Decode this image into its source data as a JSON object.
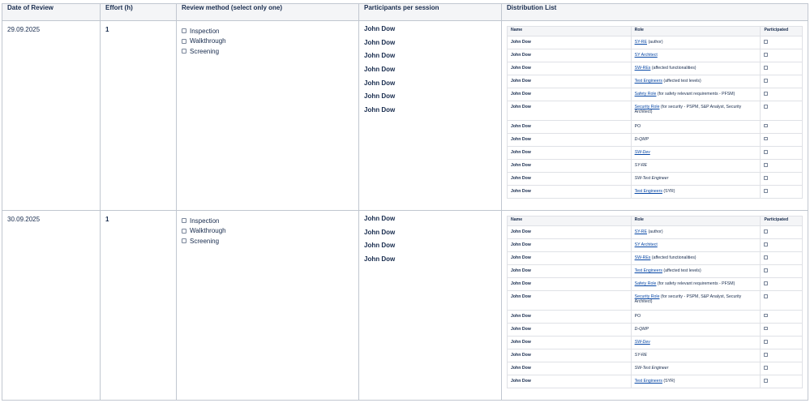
{
  "headers": {
    "date": "Date of Review",
    "effort": "Effort (h)",
    "method": "Review method (select only one)",
    "participants": "Participants per session",
    "distribution": "Distribution List"
  },
  "method_options": [
    "Inspection",
    "Walkthrough",
    "Screening"
  ],
  "distribution_headers": {
    "name": "Name",
    "role": "Role",
    "participated": "Participated"
  },
  "sessions": [
    {
      "date": "29.09.2025",
      "effort": "1",
      "participants": [
        "John Dow",
        "John Dow",
        "John Dow",
        "John Dow",
        "John Dow",
        "John Dow",
        "John Dow"
      ],
      "distribution": [
        {
          "name": "John Dow",
          "role_link": "SY-RE",
          "role_rest": " (author)",
          "italic": false
        },
        {
          "name": "John Dow",
          "role_link": "SY Architect",
          "role_rest": "",
          "italic": false
        },
        {
          "name": "John Dow",
          "role_link": "SW-REs",
          "role_rest": " (affected functionalities)",
          "italic": false
        },
        {
          "name": "John Dow",
          "role_link": "Test Engineers",
          "role_rest": " (affected test levels)",
          "italic": false
        },
        {
          "name": "John Dow",
          "role_link": "Safety Role",
          "role_rest": " (for safety relevant requirements - PFSM)",
          "italic": false
        },
        {
          "name": "John Dow",
          "role_link": "Security Role",
          "role_rest": " (for security - PSPM, S&P Analyst, Security Architect)",
          "italic": false,
          "tall": true
        },
        {
          "name": "John Dow",
          "role_link": "",
          "role_rest": "PO",
          "italic": false
        },
        {
          "name": "John Dow",
          "role_link": "",
          "role_rest": "D-QMP",
          "italic": true
        },
        {
          "name": "John Dow",
          "role_link": "SW-Dev",
          "role_rest": "",
          "italic": true
        },
        {
          "name": "John Dow",
          "role_link": "",
          "role_rest": "SY-RE",
          "italic": true
        },
        {
          "name": "John Dow",
          "role_link": "",
          "role_rest": "SW-Test Engineer",
          "italic": true
        },
        {
          "name": "John Dow",
          "role_link": "Test Engineers",
          "role_rest": " (SYR)",
          "italic": false
        }
      ]
    },
    {
      "date": "30.09.2025",
      "effort": "1",
      "participants": [
        "John Dow",
        "John Dow",
        "John Dow",
        "John Dow"
      ],
      "distribution": [
        {
          "name": "John Dow",
          "role_link": "SY-RE",
          "role_rest": " (author)",
          "italic": false
        },
        {
          "name": "John Dow",
          "role_link": "SY Architect",
          "role_rest": "",
          "italic": false
        },
        {
          "name": "John Dow",
          "role_link": "SW-REs",
          "role_rest": " (affected functionalities)",
          "italic": false
        },
        {
          "name": "John Dow",
          "role_link": "Test Engineers",
          "role_rest": " (affected test levels)",
          "italic": false
        },
        {
          "name": "John Dow",
          "role_link": "Safety Role",
          "role_rest": " (for safety relevant requirements - PFSM)",
          "italic": false
        },
        {
          "name": "John Dow",
          "role_link": "Security Role",
          "role_rest": " (for security - PSPM, S&P Analyst, Security Architect)",
          "italic": false,
          "tall": true
        },
        {
          "name": "John Dow",
          "role_link": "",
          "role_rest": "PO",
          "italic": false
        },
        {
          "name": "John Dow",
          "role_link": "",
          "role_rest": "D-QMP",
          "italic": true
        },
        {
          "name": "John Dow",
          "role_link": "SW-Dev",
          "role_rest": "",
          "italic": true
        },
        {
          "name": "John Dow",
          "role_link": "",
          "role_rest": "SY-RE",
          "italic": true
        },
        {
          "name": "John Dow",
          "role_link": "",
          "role_rest": "SW-Test Engineer",
          "italic": true
        },
        {
          "name": "John Dow",
          "role_link": "Test Engineers",
          "role_rest": " (SYR)",
          "italic": false
        }
      ]
    }
  ]
}
